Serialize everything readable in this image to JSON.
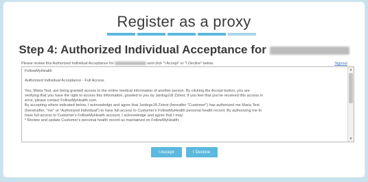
{
  "header": {
    "title": "Register as a proxy",
    "progress_steps": 5,
    "current_step": 4
  },
  "step": {
    "title_prefix": "Step 4: Authorized Individual Acceptance for"
  },
  "instruction": {
    "before": "Please review this Authorized Individual Acceptance for",
    "after": "and click \"I Accept\" or \"I Decline\" below."
  },
  "signout_label": "Signout",
  "document": {
    "lines": [
      "FollowMyHealth",
      "",
      "Authorized Individual Acceptance - Full Access",
      "",
      "You, Maria Test, are being granted access to the online medical information of another person. By clicking the Accept button, you are",
      "verifying that you have the right to access this information, granted to you by Jardogs18 Zztest. If you feel that you've received this access in",
      "error, please contact FollowMyHealth.com.",
      "By accepting where indicated below, I acknowledge and agree that Jardogs18 Zztest (hereafter \"Customer\") has authorized me Maria Test",
      "(hereinafter, \"me\" or \"Authorized Individual\") to have full access to Customer's FollowMyHealth personal health record. By authorizing me to",
      "have full access to Customer's FollowMyHealth account, I acknowledge and agree that I may:",
      "*     Review and update Customer's personal health record as maintained on FollowMyHealth;"
    ]
  },
  "buttons": {
    "accept": "I Accept",
    "decline": "I Decline"
  },
  "colors": {
    "accent": "#5bb8de",
    "progress_inactive": "#a9d6e8",
    "background": "#c9e3ee"
  }
}
